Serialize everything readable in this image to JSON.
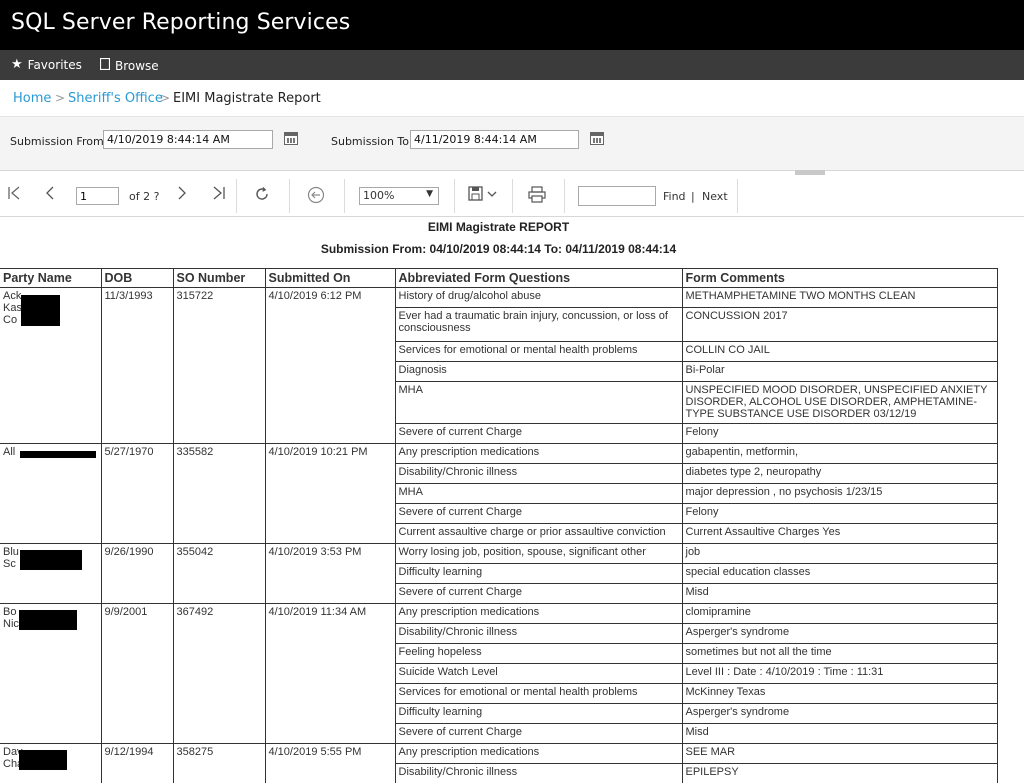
{
  "app": {
    "title": "SQL Server Reporting Services"
  },
  "nav": {
    "favorites": "Favorites",
    "browse": "Browse"
  },
  "breadcrumb": {
    "home": "Home",
    "folder": "Sheriff's Office",
    "current": "EIMI Magistrate Report",
    "sep": ">"
  },
  "params": {
    "from_label": "Submission From:",
    "from_value": "4/10/2019 8:44:14 AM",
    "to_label": "Submission To:",
    "to_value": "4/11/2019 8:44:14 AM"
  },
  "toolbar": {
    "page_value": "1",
    "page_of": "of  2 ?",
    "zoom": "100%",
    "find": "Find",
    "pipe": "|",
    "next": "Next"
  },
  "report": {
    "title": "EIMI Magistrate REPORT",
    "subtitle": "Submission From: 04/10/2019 08:44:14 To: 04/11/2019 08:44:14",
    "columns": [
      "Party Name",
      "DOB",
      "SO Number",
      "Submitted On",
      "Abbreviated Form Questions",
      "Form Comments"
    ],
    "records": [
      {
        "name": "Ack\nKas\nCo",
        "dob": "11/3/1993",
        "so": "315722",
        "submitted": "4/10/2019 6:12 PM",
        "rows": [
          [
            "History of drug/alcohol abuse",
            "METHAMPHETAMINE TWO MONTHS CLEAN"
          ],
          [
            "Ever had a traumatic brain injury, concussion, or loss of consciousness",
            "CONCUSSION 2017"
          ],
          [
            "Services for emotional or mental health problems",
            "COLLIN CO JAIL"
          ],
          [
            "Diagnosis",
            "Bi-Polar"
          ],
          [
            "MHA",
            "UNSPECIFIED MOOD DISORDER, UNSPECIFIED ANXIETY DISORDER, ALCOHOL USE DISORDER, AMPHETAMINE-TYPE SUBSTANCE USE DISORDER 03/12/19"
          ],
          [
            "Severe of current Charge",
            "Felony"
          ]
        ]
      },
      {
        "name": "All",
        "dob": "5/27/1970",
        "so": "335582",
        "submitted": "4/10/2019 10:21 PM",
        "rows": [
          [
            "Any prescription medications",
            "gabapentin, metformin,"
          ],
          [
            "Disability/Chronic illness",
            "diabetes type 2, neuropathy"
          ],
          [
            "MHA",
            "major depression , no psychosis 1/23/15"
          ],
          [
            "Severe of current Charge",
            "Felony"
          ],
          [
            "Current assaultive charge or prior assaultive conviction",
            "Current Assaultive Charges Yes"
          ]
        ]
      },
      {
        "name": "Blu\nSc",
        "dob": "9/26/1990",
        "so": "355042",
        "submitted": "4/10/2019 3:53 PM",
        "rows": [
          [
            "Worry losing job, position, spouse, significant other",
            "job"
          ],
          [
            "Difficulty learning",
            "special education classes"
          ],
          [
            "Severe of current Charge",
            "Misd"
          ]
        ]
      },
      {
        "name": "Bo\nNic",
        "dob": "9/9/2001",
        "so": "367492",
        "submitted": "4/10/2019 11:34 AM",
        "rows": [
          [
            "Any prescription medications",
            "clomipramine"
          ],
          [
            "Disability/Chronic illness",
            "Asperger's syndrome"
          ],
          [
            "Feeling hopeless",
            "sometimes but not all the time"
          ],
          [
            "Suicide Watch Level",
            "Level III : Date : 4/10/2019 : Time : 11:31"
          ],
          [
            "Services for emotional or mental health problems",
            "McKinney Texas"
          ],
          [
            "Difficulty learning",
            "Asperger's syndrome"
          ],
          [
            "Severe of current Charge",
            "Misd"
          ]
        ]
      },
      {
        "name": "Dav\nCha",
        "dob": "9/12/1994",
        "so": "358275",
        "submitted": "4/10/2019 5:55 PM",
        "rows": [
          [
            "Any prescription medications",
            "SEE MAR"
          ],
          [
            "Disability/Chronic illness",
            "EPILEPSY"
          ]
        ]
      }
    ]
  }
}
